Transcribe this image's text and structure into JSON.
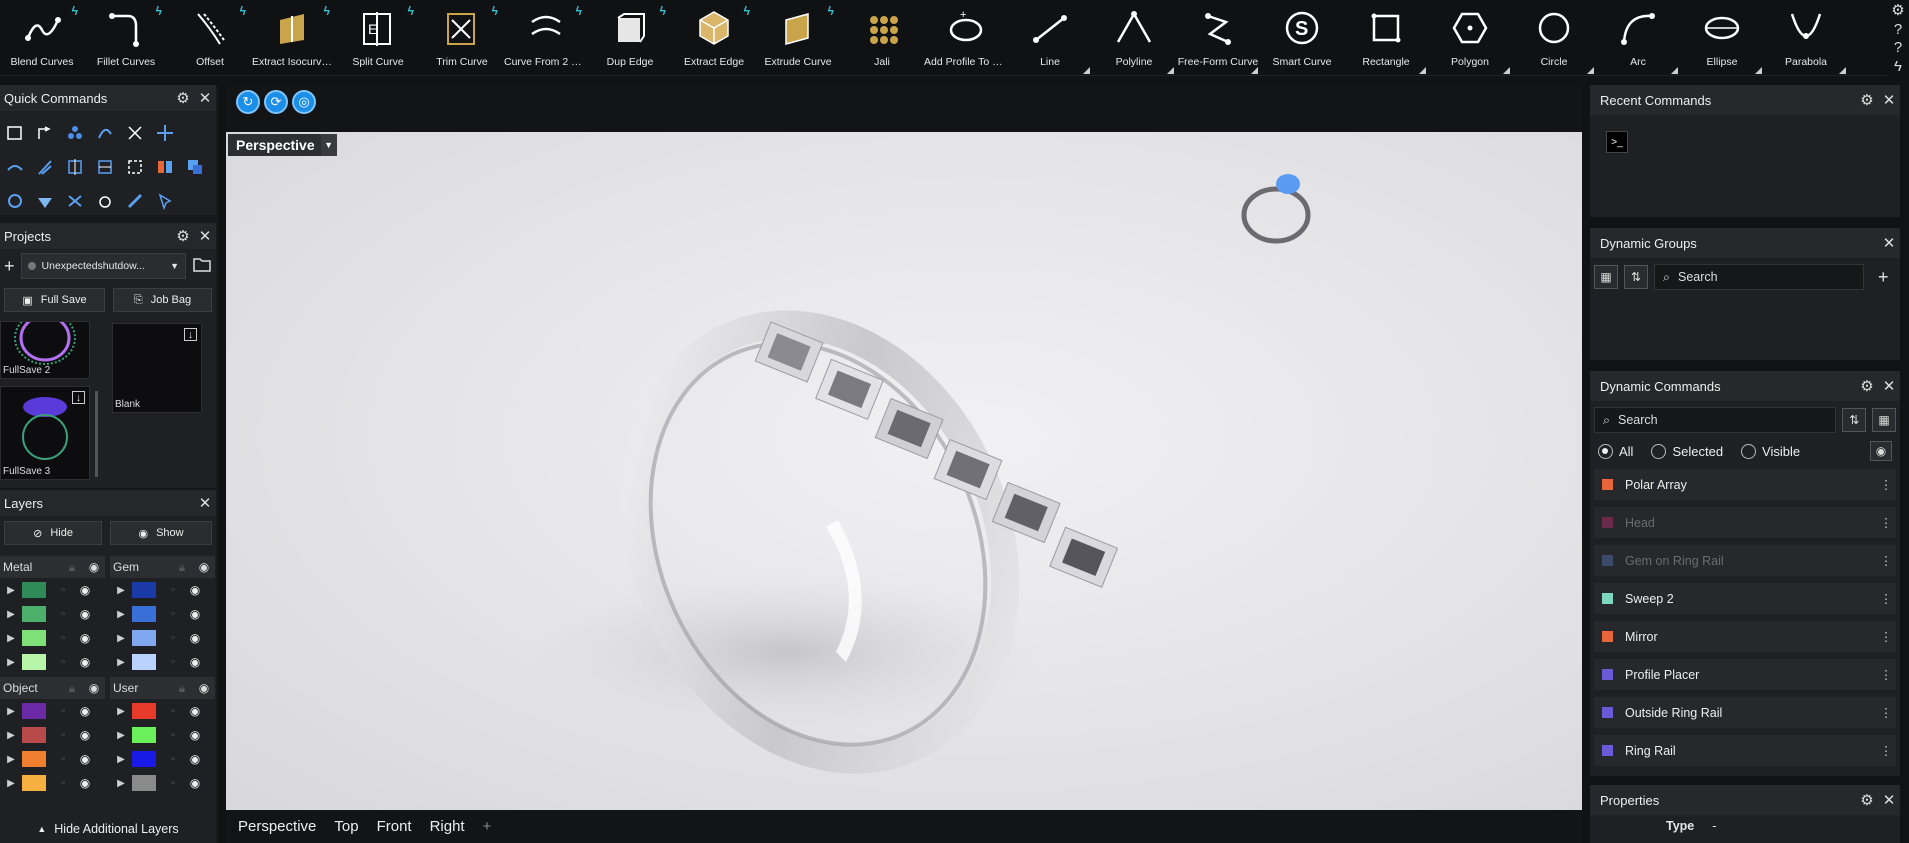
{
  "toolbar": {
    "tools": [
      {
        "label": "Blend Curves",
        "icon": "blend-curves-icon",
        "flash": true,
        "corner": false
      },
      {
        "label": "Fillet Curves",
        "icon": "fillet-curves-icon",
        "flash": true,
        "corner": false
      },
      {
        "label": "Offset",
        "icon": "offset-icon",
        "flash": true,
        "corner": false
      },
      {
        "label": "Extract Isocurve Fr...",
        "icon": "extract-isocurve-icon",
        "flash": true,
        "corner": false
      },
      {
        "label": "Split Curve",
        "icon": "split-curve-icon",
        "flash": true,
        "corner": false
      },
      {
        "label": "Trim Curve",
        "icon": "trim-curve-icon",
        "flash": true,
        "corner": false
      },
      {
        "label": "Curve From 2 Views",
        "icon": "curve-from-2-views-icon",
        "flash": true,
        "corner": false
      },
      {
        "label": "Dup Edge",
        "icon": "dup-edge-icon",
        "flash": true,
        "corner": false
      },
      {
        "label": "Extract Edge",
        "icon": "extract-edge-icon",
        "flash": true,
        "corner": false
      },
      {
        "label": "Extrude Curve",
        "icon": "extrude-curve-icon",
        "flash": true,
        "corner": false
      },
      {
        "label": "Jali",
        "icon": "jali-icon",
        "flash": false,
        "corner": false
      },
      {
        "label": "Add Profile To Libr...",
        "icon": "add-profile-icon",
        "flash": false,
        "corner": false
      },
      {
        "label": "Line",
        "icon": "line-icon",
        "flash": false,
        "corner": true
      },
      {
        "label": "Polyline",
        "icon": "polyline-icon",
        "flash": false,
        "corner": true
      },
      {
        "label": "Free-Form Curve",
        "icon": "free-form-curve-icon",
        "flash": false,
        "corner": true
      },
      {
        "label": "Smart Curve",
        "icon": "smart-curve-icon",
        "flash": false,
        "corner": false
      },
      {
        "label": "Rectangle",
        "icon": "rectangle-icon",
        "flash": false,
        "corner": true
      },
      {
        "label": "Polygon",
        "icon": "polygon-icon",
        "flash": false,
        "corner": true
      },
      {
        "label": "Circle",
        "icon": "circle-icon",
        "flash": false,
        "corner": true
      },
      {
        "label": "Arc",
        "icon": "arc-icon",
        "flash": false,
        "corner": true
      },
      {
        "label": "Ellipse",
        "icon": "ellipse-icon",
        "flash": false,
        "corner": true
      },
      {
        "label": "Parabola",
        "icon": "parabola-icon",
        "flash": false,
        "corner": true
      }
    ],
    "right_glyphs": [
      "⚙",
      "?",
      "?",
      "ϟ"
    ]
  },
  "quick_commands": {
    "title": "Quick Commands"
  },
  "projects": {
    "title": "Projects",
    "dropdown_value": "Unexpectedshutdow...",
    "full_save_label": "Full Save",
    "job_bag_label": "Job Bag",
    "thumbs": [
      {
        "name": "FullSave 2"
      },
      {
        "name": "Blank"
      },
      {
        "name": "FullSave 3"
      }
    ]
  },
  "layers": {
    "title": "Layers",
    "hide_label": "Hide",
    "show_label": "Show",
    "groups": [
      {
        "name": "Metal",
        "colors": [
          "#2e8b57",
          "#4caf6a",
          "#7fe07a",
          "#b7f5a8"
        ]
      },
      {
        "name": "Gem",
        "colors": [
          "#1a3aa8",
          "#3a6fd8",
          "#7fa8f0",
          "#b9d2ff"
        ]
      },
      {
        "name": "Object",
        "colors": [
          "#6a2aa8",
          "#b84a4a",
          "#f08030",
          "#f5b040"
        ]
      },
      {
        "name": "User",
        "colors": [
          "#e83a2a",
          "#6af05a",
          "#1a1ae8",
          "#8a8a8a"
        ]
      }
    ],
    "more_label": "Hide Additional Layers"
  },
  "viewport": {
    "label": "Perspective",
    "tabs": [
      "Perspective",
      "Top",
      "Front",
      "Right"
    ],
    "add_tab_glyph": "+"
  },
  "recent_commands": {
    "title": "Recent Commands"
  },
  "dynamic_groups": {
    "title": "Dynamic Groups",
    "search_placeholder": "Search"
  },
  "dynamic_commands": {
    "title": "Dynamic Commands",
    "search_placeholder": "Search",
    "filters": [
      "All",
      "Selected",
      "Visible"
    ],
    "selected_filter": "All",
    "items": [
      {
        "name": "Polar Array",
        "color": "#e8663a",
        "dim": false
      },
      {
        "name": "Head",
        "color": "#6a2a4a",
        "dim": true
      },
      {
        "name": "Gem on Ring Rail",
        "color": "#3a4a6a",
        "dim": true
      },
      {
        "name": "Sweep 2",
        "color": "#7ed6c0",
        "dim": false
      },
      {
        "name": "Mirror",
        "color": "#e8663a",
        "dim": false
      },
      {
        "name": "Profile Placer",
        "color": "#6a5ad8",
        "dim": false
      },
      {
        "name": "Outside Ring Rail",
        "color": "#6a5ad8",
        "dim": false
      },
      {
        "name": "Ring Rail",
        "color": "#6a5ad8",
        "dim": false
      }
    ]
  },
  "properties": {
    "title": "Properties",
    "type_label": "Type",
    "type_value": "-"
  }
}
